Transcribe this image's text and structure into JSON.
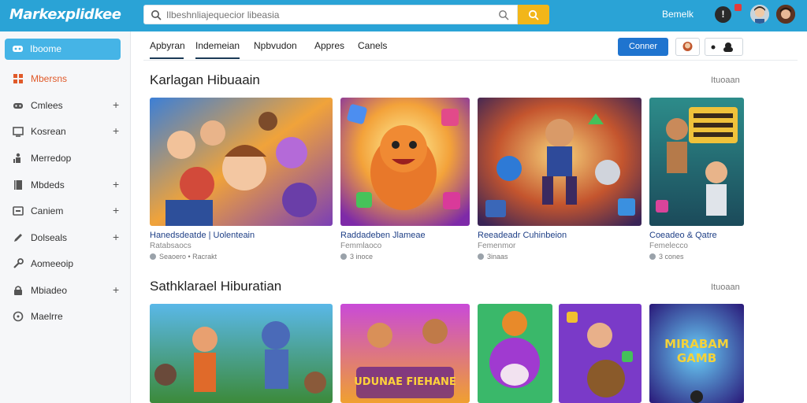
{
  "header": {
    "brand": "Markexplidkee",
    "search_placeholder": "Ilbeshnliajequecior libeasia",
    "user_name": "Bemelk",
    "notif_glyph": "!",
    "accent": "#2aa3d6",
    "search_button_color": "#f2b619"
  },
  "sidebar": {
    "home_label": "Iboome",
    "items": [
      {
        "label": "Mbersns",
        "icon": "grid-icon",
        "plus": ""
      },
      {
        "label": "Cmlees",
        "icon": "gamepad-icon",
        "plus": "+"
      },
      {
        "label": "Kosrean",
        "icon": "monitor-icon",
        "plus": "+"
      },
      {
        "label": "Merredop",
        "icon": "figure-icon",
        "plus": ""
      },
      {
        "label": "Mbdeds",
        "icon": "book-icon",
        "plus": "+"
      },
      {
        "label": "Caniem",
        "icon": "screen-icon",
        "plus": "+"
      },
      {
        "label": "Dolseals",
        "icon": "pencil-icon",
        "plus": "+"
      },
      {
        "label": "Aomeeoip",
        "icon": "tools-icon",
        "plus": ""
      },
      {
        "label": "Mbiadeo",
        "icon": "lock-icon",
        "plus": "+"
      },
      {
        "label": "Maelrre",
        "icon": "clock-icon",
        "plus": ""
      }
    ]
  },
  "tabs": [
    "Apbyran",
    "Indemeian",
    "Npbvudon",
    "Appres",
    "Canels"
  ],
  "actions": {
    "connect_label": "Conner"
  },
  "sections": [
    {
      "title": "Karlagan Hibuaain",
      "more": "Ituoaan",
      "cards": [
        {
          "title": "Hanedsdeatde | Uolenteain",
          "meta": "Ratabsaocs",
          "stat": "Seaoero • Racrakt"
        },
        {
          "title": "Raddadeben Jlameae",
          "meta": "Femmlaoco",
          "stat": "3 inoce"
        },
        {
          "title": "Reeadeadr Cuhinbeion",
          "meta": "Femenmor",
          "stat": "3inaas"
        },
        {
          "title": "Coeadeo & Qatre",
          "meta": "Femelecco",
          "stat": "3 cones"
        }
      ]
    },
    {
      "title": "Sathklarael Hiburatian",
      "more": "Ituoaan",
      "cards": [
        {
          "banner": ""
        },
        {
          "banner": "UDUNAE FIEHANE"
        },
        {
          "banner": ""
        },
        {
          "banner": ""
        },
        {
          "banner": "MIRABAM GAMB"
        }
      ]
    }
  ]
}
